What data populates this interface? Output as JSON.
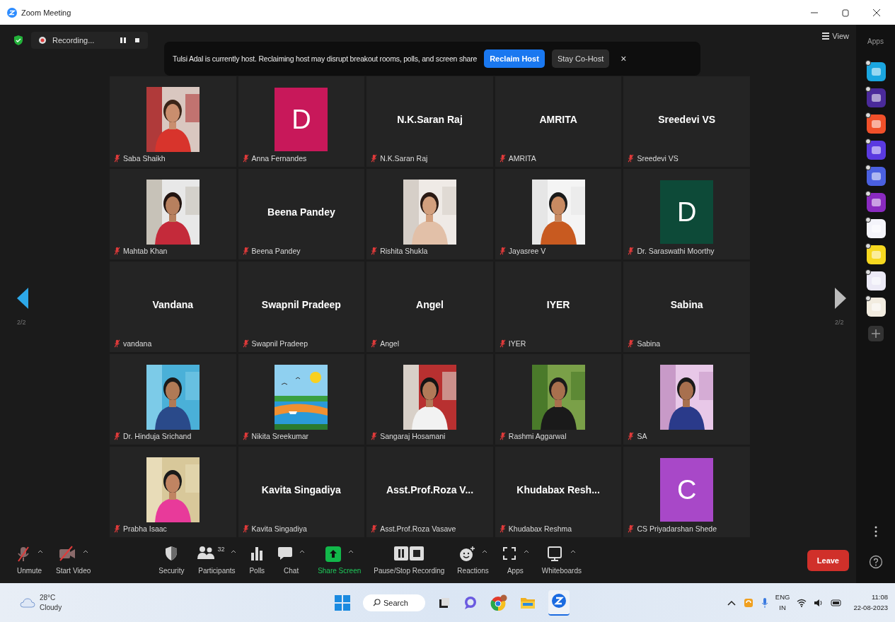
{
  "window": {
    "title": "Zoom Meeting"
  },
  "top_bar": {
    "recording_label": "Recording...",
    "banner": {
      "message": "Tulsi Adal is currently host. Reclaiming host may disrupt breakout rooms, polls, and screen share",
      "primary_button": "Reclaim Host",
      "secondary_button": "Stay Co-Host",
      "close": "×"
    },
    "view_button": "View"
  },
  "pager": {
    "left_label": "2/2",
    "right_label": "2/2"
  },
  "tiles": [
    {
      "kind": "picture",
      "caption": "Saba Shaikh",
      "muted": true
    },
    {
      "kind": "avatar",
      "letter": "D",
      "color": "#c8185a",
      "caption": "Anna Fernandes",
      "muted": true
    },
    {
      "kind": "name",
      "title": "N.K.Saran Raj",
      "caption": "N.K.Saran Raj",
      "muted": true
    },
    {
      "kind": "name",
      "title": "AMRITA",
      "caption": "AMRITA",
      "muted": true
    },
    {
      "kind": "name",
      "title": "Sreedevi VS",
      "caption": "Sreedevi VS",
      "muted": true
    },
    {
      "kind": "picture",
      "caption": "Mahtab Khan",
      "muted": true
    },
    {
      "kind": "name",
      "title": "Beena Pandey",
      "caption": "Beena Pandey",
      "muted": true
    },
    {
      "kind": "picture",
      "caption": "Rishita Shukla",
      "muted": true
    },
    {
      "kind": "picture",
      "caption": "Jayasree V",
      "muted": true
    },
    {
      "kind": "avatar",
      "letter": "D",
      "color": "#0d4a38",
      "caption": "Dr. Saraswathi Moorthy",
      "muted": true
    },
    {
      "kind": "name",
      "title": "Vandana",
      "caption": "vandana",
      "muted": true
    },
    {
      "kind": "name",
      "title": "Swapnil Pradeep",
      "caption": "Swapnil Pradeep",
      "muted": true
    },
    {
      "kind": "name",
      "title": "Angel",
      "caption": "Angel",
      "muted": true
    },
    {
      "kind": "name",
      "title": "IYER",
      "caption": "IYER",
      "muted": true
    },
    {
      "kind": "name",
      "title": "Sabina",
      "caption": "Sabina",
      "muted": true
    },
    {
      "kind": "picture",
      "caption": "Dr. Hinduja Srichand",
      "muted": true
    },
    {
      "kind": "picture",
      "caption": "Nikita Sreekumar",
      "muted": true
    },
    {
      "kind": "picture",
      "caption": "Sangaraj Hosamani",
      "muted": true
    },
    {
      "kind": "picture",
      "caption": "Rashmi Aggarwal",
      "muted": true
    },
    {
      "kind": "picture",
      "caption": "SA",
      "muted": true
    },
    {
      "kind": "picture",
      "caption": "Prabha Isaac",
      "muted": true
    },
    {
      "kind": "name",
      "title": "Kavita Singadiya",
      "caption": "Kavita Singadiya",
      "muted": true
    },
    {
      "kind": "name",
      "title": "Asst.Prof.Roza V...",
      "caption": "Asst.Prof.Roza Vasave",
      "muted": true
    },
    {
      "kind": "name",
      "title": "Khudabax  Resh...",
      "caption": "Khudabax Reshma",
      "muted": true
    },
    {
      "kind": "avatar",
      "letter": "C",
      "color": "#a848c8",
      "caption": "CS Priyadarshan Shede",
      "muted": true
    }
  ],
  "apps_panel": {
    "title": "Apps",
    "apps": [
      {
        "color": "#1aa6e0"
      },
      {
        "color": "#4a2a9a"
      },
      {
        "color": "#f0502a"
      },
      {
        "color": "#5a3ae0"
      },
      {
        "color": "#4a60e0"
      },
      {
        "color": "#8a2ac0"
      },
      {
        "color": "#f4f4fa"
      },
      {
        "color": "#f6d820"
      },
      {
        "color": "#eceaf6"
      },
      {
        "color": "#f2ece0"
      }
    ]
  },
  "toolbar": {
    "items": [
      {
        "label": "Unmute",
        "caret": true,
        "accent": false
      },
      {
        "label": "Start Video",
        "caret": true,
        "accent": false
      },
      {
        "label": "Security",
        "caret": false,
        "accent": false
      },
      {
        "label": "Participants",
        "count": "32",
        "caret": true,
        "accent": false
      },
      {
        "label": "Polls",
        "caret": false,
        "accent": false
      },
      {
        "label": "Chat",
        "caret": true,
        "accent": false
      },
      {
        "label": "Share Screen",
        "caret": true,
        "accent": true
      },
      {
        "label": "Pause/Stop Recording",
        "caret": false,
        "accent": false
      },
      {
        "label": "Reactions",
        "caret": true,
        "accent": false
      },
      {
        "label": "Apps",
        "caret": true,
        "accent": false
      },
      {
        "label": "Whiteboards",
        "caret": true,
        "accent": false
      }
    ],
    "leave_button": "Leave"
  },
  "taskbar": {
    "weather": {
      "temperature": "28°C",
      "condition": "Cloudy"
    },
    "search": "Search",
    "language": "ENG",
    "region": "IN",
    "time": "11:08",
    "date": "22-08-2023"
  }
}
